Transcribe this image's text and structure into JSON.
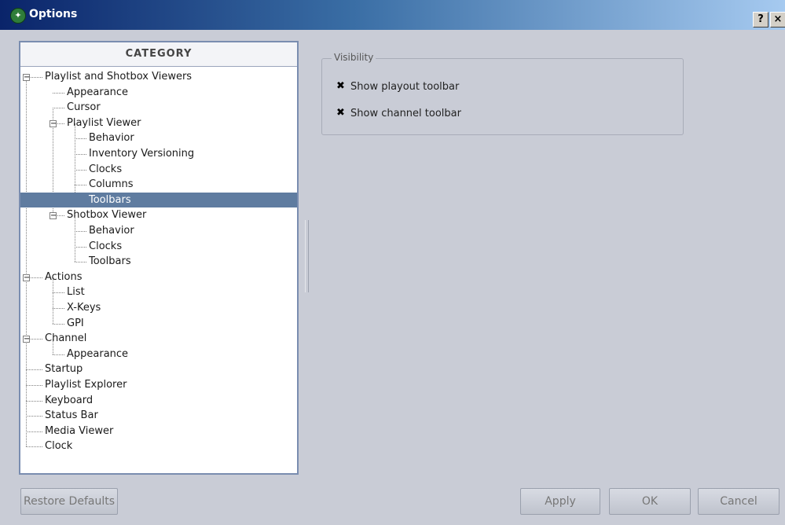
{
  "window": {
    "title": "Options",
    "help_label": "?",
    "close_label": "×",
    "logo_glyph": "✦"
  },
  "category": {
    "header": "CATEGORY",
    "items": [
      {
        "label": "Playlist and Shotbox Viewers",
        "expanded": true
      },
      {
        "label": "Appearance"
      },
      {
        "label": "Cursor"
      },
      {
        "label": "Playlist Viewer",
        "expanded": true
      },
      {
        "label": "Behavior"
      },
      {
        "label": "Inventory Versioning"
      },
      {
        "label": "Clocks"
      },
      {
        "label": "Columns"
      },
      {
        "label": "Toolbars",
        "selected": true
      },
      {
        "label": "Shotbox Viewer",
        "expanded": true
      },
      {
        "label": "Behavior"
      },
      {
        "label": "Clocks"
      },
      {
        "label": "Toolbars"
      },
      {
        "label": "Actions",
        "expanded": true
      },
      {
        "label": "List"
      },
      {
        "label": "X-Keys"
      },
      {
        "label": "GPI"
      },
      {
        "label": "Channel",
        "expanded": true
      },
      {
        "label": "Appearance"
      },
      {
        "label": "Startup"
      },
      {
        "label": "Playlist Explorer"
      },
      {
        "label": "Keyboard"
      },
      {
        "label": "Status Bar"
      },
      {
        "label": "Media Viewer"
      },
      {
        "label": "Clock"
      }
    ]
  },
  "visibility": {
    "legend": "Visibility",
    "options": [
      {
        "label": "Show playout toolbar",
        "checked": true
      },
      {
        "label": "Show channel toolbar",
        "checked": true
      }
    ]
  },
  "buttons": {
    "restore_defaults": "Restore Defaults",
    "apply": "Apply",
    "ok": "OK",
    "cancel": "Cancel"
  },
  "colors": {
    "titlebar_start": "#0a246a",
    "titlebar_end": "#a6caf0",
    "selection": "#5f7ca0",
    "background": "#c9ccd6"
  },
  "icons": {
    "expander_glyph": "−",
    "check_glyph": "✖"
  }
}
